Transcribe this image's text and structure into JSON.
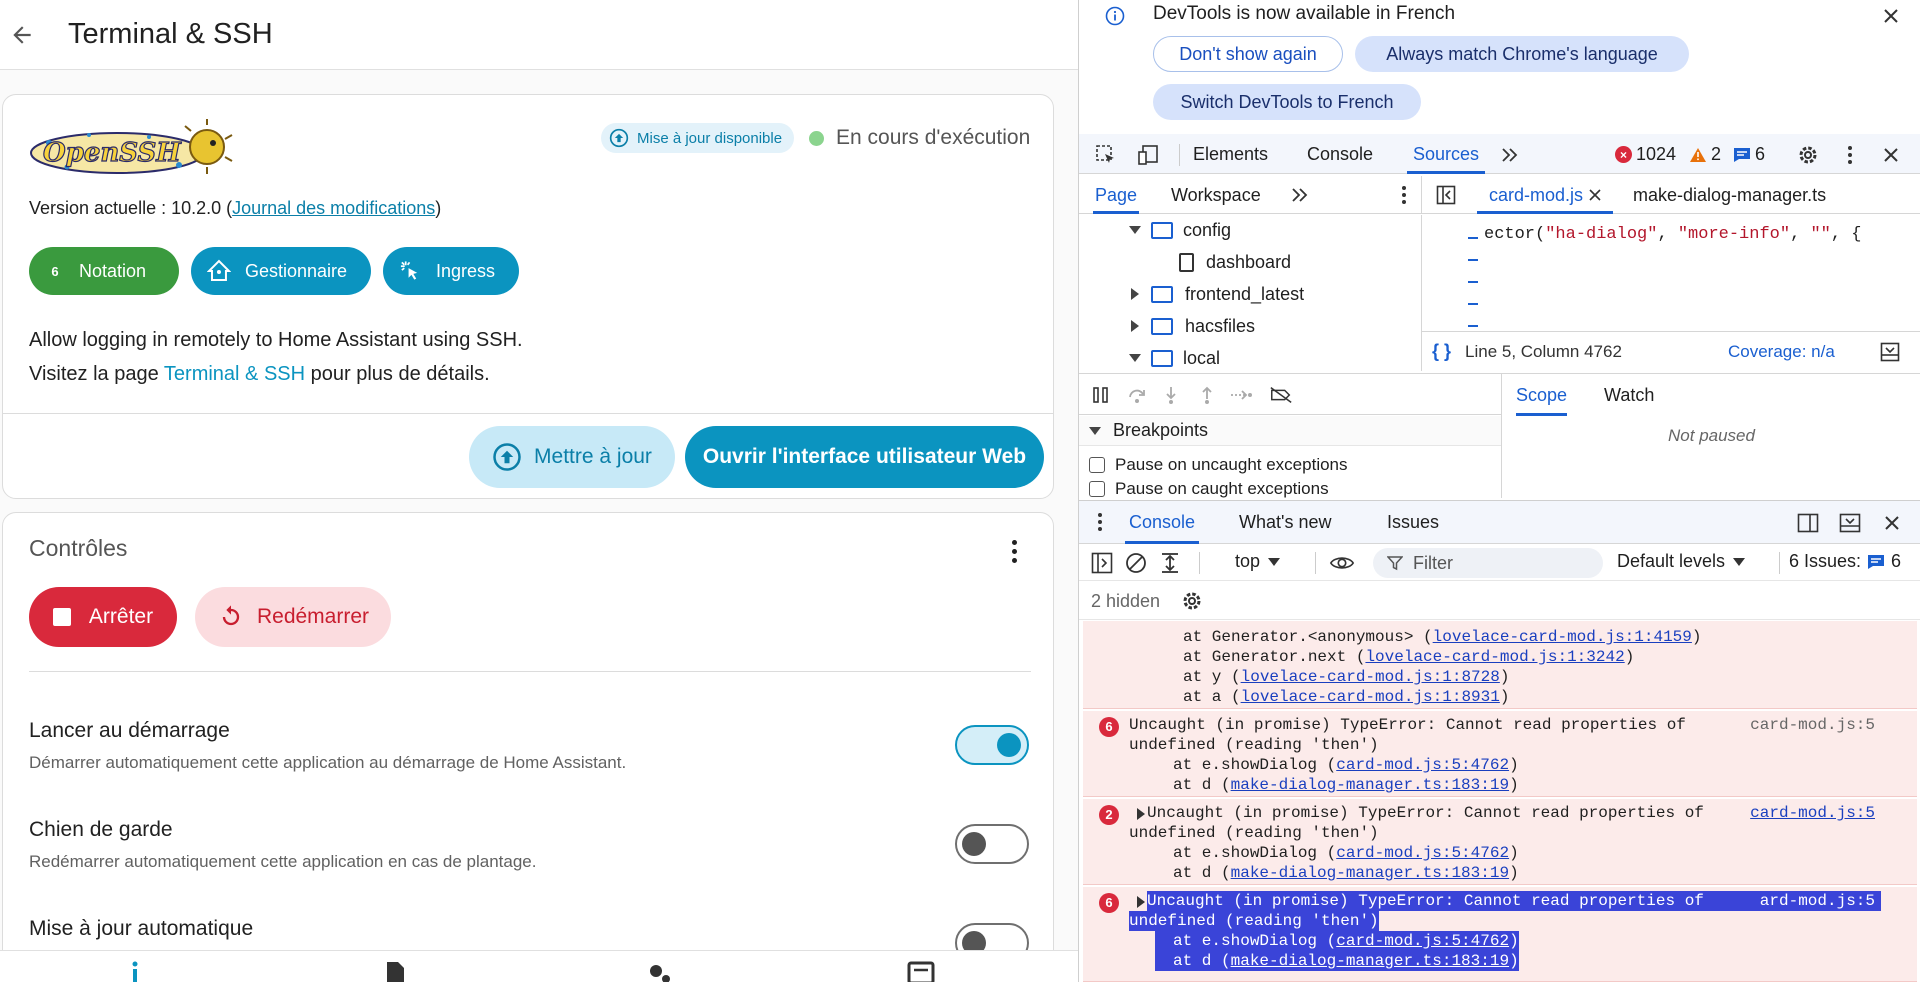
{
  "ha": {
    "title": "Terminal & SSH",
    "logo_text": "OpenSSH",
    "update_chip": "Mise à jour disponible",
    "status": "En cours d'exécution",
    "version_prefix": "Version actuelle : 10.2.0 (",
    "changelog_link": "Journal des modifications",
    "version_suffix": ")",
    "chips": {
      "rating_value": "6",
      "rating_label": "Notation",
      "manager_label": "Gestionnaire",
      "ingress_label": "Ingress"
    },
    "description_line1": "Allow logging in remotely to Home Assistant using SSH.",
    "visit_prefix": "Visitez la page ",
    "visit_link": "Terminal & SSH",
    "visit_suffix": " pour plus de détails.",
    "update_button": "Mettre à jour",
    "open_web_ui_button": "Ouvrir l'interface utilisateur Web",
    "controls": {
      "title": "Contrôles",
      "stop_button": "Arrêter",
      "restart_button": "Redémarrer",
      "options": [
        {
          "title": "Lancer au démarrage",
          "subtitle": "Démarrer automatiquement cette application au démarrage de Home Assistant.",
          "enabled": true
        },
        {
          "title": "Chien de garde",
          "subtitle": "Redémarrer automatiquement cette application en cas de plantage.",
          "enabled": false
        },
        {
          "title": "Mise à jour automatique",
          "subtitle": "",
          "enabled": false
        }
      ]
    },
    "colors": {
      "primary": "#0b94c0",
      "danger": "#d9293c",
      "success": "#3a9a3e"
    }
  },
  "devtools": {
    "lang_banner": {
      "message": "DevTools is now available in French",
      "dont_show": "Don't show again",
      "always_match": "Always match Chrome's language",
      "switch": "Switch DevTools to French"
    },
    "main_tabs": [
      "Elements",
      "Console",
      "Sources"
    ],
    "active_main_tab": "Sources",
    "counts": {
      "errors": "1024",
      "warnings": "2",
      "messages": "6"
    },
    "nav_tabs": [
      "Page",
      "Workspace"
    ],
    "file_tabs": [
      "card-mod.js",
      "make-dialog-manager.ts"
    ],
    "tree": [
      {
        "label": "config",
        "type": "folder",
        "expanded": true
      },
      {
        "label": "dashboard",
        "type": "file"
      },
      {
        "label": "frontend_latest",
        "type": "folder",
        "expanded": false
      },
      {
        "label": "hacsfiles",
        "type": "folder",
        "expanded": false
      },
      {
        "label": "local",
        "type": "folder",
        "expanded": true
      }
    ],
    "code": {
      "prefix": "ector(",
      "s1": "\"ha-dialog\"",
      "mid": ", ",
      "s2": "\"more-info\"",
      "s3": "\"\"",
      "suffix": ", {"
    },
    "cursor_position": "Line 5, Column 4762",
    "coverage": "Coverage: n/a",
    "scope_tabs": [
      "Scope",
      "Watch"
    ],
    "not_paused": "Not paused",
    "breakpoints_header": "Breakpoints",
    "bp_uncaught": "Pause on uncaught exceptions",
    "bp_caught": "Pause on caught exceptions",
    "drawer_tabs": [
      "Console",
      "What's new",
      "Issues"
    ],
    "context": "top",
    "filter_placeholder": "Filter",
    "levels": "Default levels",
    "issues_label": "6 Issues:",
    "issues_count": "6",
    "hidden_count": "2 hidden",
    "logs": {
      "stack0": [
        {
          "pre": "at Generator.<anonymous> (",
          "link": "lovelace-card-mod.js:1:4159",
          "post": ")"
        },
        {
          "pre": "at Generator.next (",
          "link": "lovelace-card-mod.js:1:3242",
          "post": ")"
        },
        {
          "pre": "at y (",
          "link": "lovelace-card-mod.js:1:8728",
          "post": ")"
        },
        {
          "pre": "at a (",
          "link": "lovelace-card-mod.js:1:8931",
          "post": ")"
        }
      ],
      "entries": [
        {
          "count": "6",
          "line1": "Uncaught (in promise) TypeError: Cannot read properties of",
          "line2": "undefined (reading 'then')",
          "source": "card-mod.js:5",
          "frames": [
            {
              "pre": "at e.showDialog (",
              "link": "card-mod.js:5:4762",
              "post": ")"
            },
            {
              "pre": "at d (",
              "link": "make-dialog-manager.ts:183:19",
              "post": ")"
            }
          ]
        },
        {
          "count": "2",
          "line1": "Uncaught (in promise) TypeError: Cannot read properties of",
          "line2": "undefined (reading 'then')",
          "source": "card-mod.js:5",
          "frames": [
            {
              "pre": "at e.showDialog (",
              "link": "card-mod.js:5:4762",
              "post": ")"
            },
            {
              "pre": "at d (",
              "link": "make-dialog-manager.ts:183:19",
              "post": ")"
            }
          ]
        },
        {
          "count": "6",
          "line1": "Uncaught (in promise) TypeError: Cannot read properties of",
          "line2": "undefined (reading 'then')",
          "source": "ard-mod.js:5",
          "frames": [
            {
              "pre": "at e.showDialog (",
              "link": "card-mod.js:5:4762",
              "post": ")"
            },
            {
              "pre": "at d (",
              "link": "make-dialog-manager.ts:183:19",
              "post": ")"
            }
          ]
        }
      ]
    }
  }
}
